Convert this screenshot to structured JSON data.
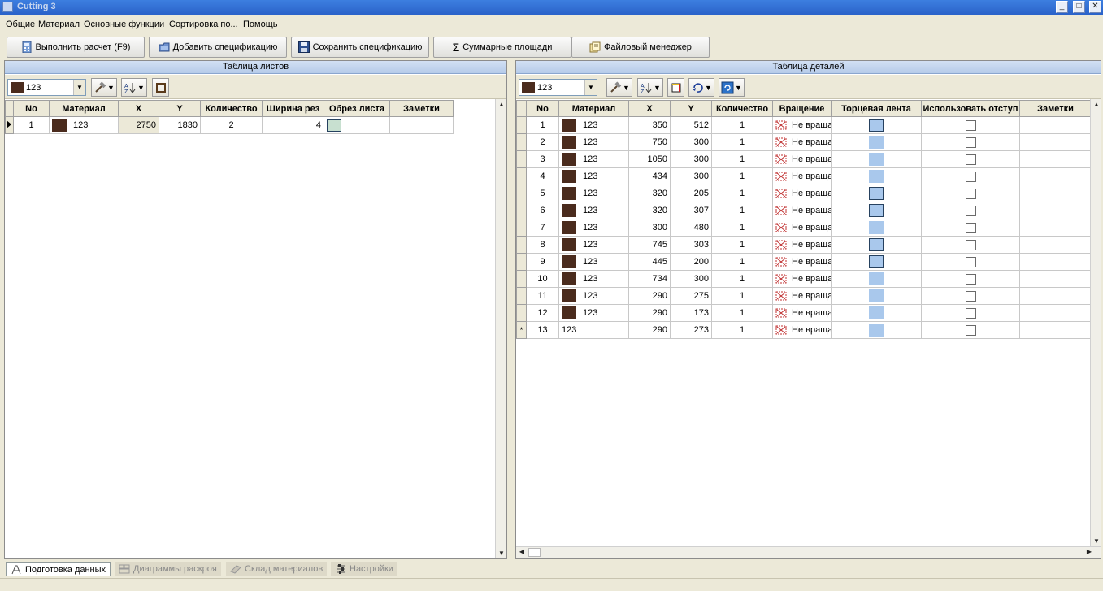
{
  "window": {
    "title": "Cutting 3",
    "btn_min": "_",
    "btn_max": "□",
    "btn_close": "✕"
  },
  "menu": {
    "general": "Общие",
    "material": "Материал",
    "main_functions": "Основные функции",
    "sorting": "Сортировка по...",
    "help": "Помощь"
  },
  "toolbar": {
    "run": "Выполнить расчет (F9)",
    "add_spec": "Добавить спецификацию",
    "save_spec": "Сохранить спецификацию",
    "sum_areas": "Суммарные площади",
    "file_manager": "Файловый менеджер"
  },
  "sheets_panel": {
    "title": "Таблица листов",
    "material_combo": "123",
    "columns": [
      "No",
      "Материал",
      "X",
      "Y",
      "Количество",
      "Ширина рез",
      "Обрез листа",
      "Заметки"
    ],
    "rows": [
      {
        "no": "1",
        "material": "123",
        "x": "2750",
        "y": "1830",
        "qty": "2",
        "cut_width": "4"
      }
    ]
  },
  "parts_panel": {
    "title": "Таблица деталей",
    "material_combo": "123",
    "columns": [
      "No",
      "Материал",
      "X",
      "Y",
      "Количество",
      "Вращение",
      "Торцевая лента",
      "Использовать отступ",
      "Заметки"
    ],
    "rows": [
      {
        "no": "1",
        "material": "123",
        "x": "350",
        "y": "512",
        "qty": "1",
        "rotation": "Не вращать"
      },
      {
        "no": "2",
        "material": "123",
        "x": "750",
        "y": "300",
        "qty": "1",
        "rotation": "Не вращать"
      },
      {
        "no": "3",
        "material": "123",
        "x": "1050",
        "y": "300",
        "qty": "1",
        "rotation": "Не вращать"
      },
      {
        "no": "4",
        "material": "123",
        "x": "434",
        "y": "300",
        "qty": "1",
        "rotation": "Не вращать"
      },
      {
        "no": "5",
        "material": "123",
        "x": "320",
        "y": "205",
        "qty": "1",
        "rotation": "Не вращать"
      },
      {
        "no": "6",
        "material": "123",
        "x": "320",
        "y": "307",
        "qty": "1",
        "rotation": "Не вращать"
      },
      {
        "no": "7",
        "material": "123",
        "x": "300",
        "y": "480",
        "qty": "1",
        "rotation": "Не вращать"
      },
      {
        "no": "8",
        "material": "123",
        "x": "745",
        "y": "303",
        "qty": "1",
        "rotation": "Не вращать"
      },
      {
        "no": "9",
        "material": "123",
        "x": "445",
        "y": "200",
        "qty": "1",
        "rotation": "Не вращать"
      },
      {
        "no": "10",
        "material": "123",
        "x": "734",
        "y": "300",
        "qty": "1",
        "rotation": "Не вращать"
      },
      {
        "no": "11",
        "material": "123",
        "x": "290",
        "y": "275",
        "qty": "1",
        "rotation": "Не вращать"
      },
      {
        "no": "12",
        "material": "123",
        "x": "290",
        "y": "173",
        "qty": "1",
        "rotation": "Не вращать"
      },
      {
        "no": "13",
        "material": "123",
        "x": "290",
        "y": "273",
        "qty": "1",
        "rotation": "Не вращать"
      }
    ]
  },
  "tabs": {
    "data_prep": "Подготовка данных",
    "cut_diagrams": "Диаграммы раскроя",
    "materials_stock": "Склад материалов",
    "settings": "Настройки"
  },
  "colors": {
    "material": "#4a2b1d",
    "edge_band": "#a9c8ec",
    "header_blue": "#b5cbe9"
  }
}
